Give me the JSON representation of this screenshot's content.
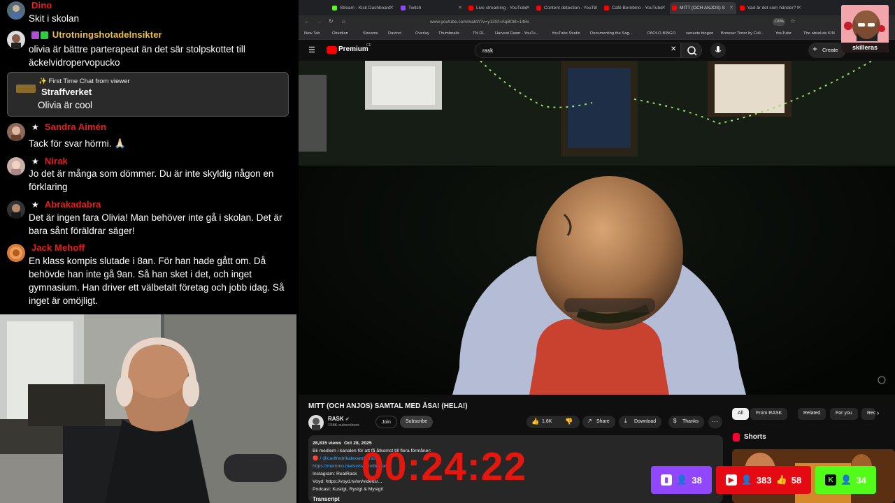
{
  "chat": {
    "messages": [
      {
        "user": "Dino",
        "color": "#e91e1e",
        "text": "Skit i skolan",
        "star": false
      },
      {
        "user": "UtrotningshotadeInsikter",
        "color": "#f0c040",
        "text": "olivia är bättre parterapeut än det sär stolpskottet till äckelvidropervopucko",
        "star": false
      },
      {
        "user": "Sandra Aimén",
        "color": "#e91e1e",
        "text": "Tack för svar hörrni. 🙏🏻",
        "star": true
      },
      {
        "user": "Nirak",
        "color": "#e91e1e",
        "text": "Jo det är många som dömmer. Du är inte skyldig någon en förklaring",
        "star": true
      },
      {
        "user": "Abrakadabra",
        "color": "#e91e1e",
        "text": "Det är ingen fara Olivia! Man behöver inte gå i skolan. Det är bara sånt föräldrar säger!",
        "star": true
      },
      {
        "user": "Jack Mehoff",
        "color": "#e91e1e",
        "text": "En klass kompis slutade i 8an. För han hade gått om. Då behövde han inte gå 9an. Så han sket i det, och inget gymnasium. Han driver ett välbetalt företag och jobb idag. Så inget är omöjligt.",
        "star": false
      }
    ],
    "first_time": {
      "header": "✨ First Time Chat from viewer",
      "user": "Straffverket",
      "text": "Olivia är cool"
    }
  },
  "browser": {
    "tabs": [
      {
        "label": "Stream - Kick Dashboard",
        "color": "#53fc18"
      },
      {
        "label": "Twitch",
        "color": "#9146ff"
      },
      {
        "label": "Live streaming - YouTube",
        "color": "#ff0000"
      },
      {
        "label": "Content detection - YouTu",
        "color": "#ff0000"
      },
      {
        "label": "Café Bernbino - YouTube",
        "color": "#ff0000"
      },
      {
        "label": "MITT (OCH ANJOS) S",
        "color": "#ff0000"
      },
      {
        "label": "Vad är det som händer? I",
        "color": "#ff0000"
      }
    ],
    "url": "www.youtube.com/watch?v=y13Sf-lAqB08t=148s",
    "zoom": "110%",
    "bookmarks": [
      "New Tab",
      "Obsidian",
      "Streams",
      "Davinci",
      "Overlay",
      "Thumbnails",
      "TN DL",
      "Harvest Dawn - YouTu...",
      "YouTube Studio",
      "Documenting the Sag...",
      "PAOLO-BINGO",
      "senaste bingoo",
      "Browser Timer by Coll...",
      "YouTube",
      "The absolute KIN"
    ]
  },
  "youtube": {
    "logo_text": "Premium",
    "logo_sup": "CE",
    "search_value": "rask",
    "create_label": "Create",
    "video_title": "MITT (OCH ANJOS) SAMTAL MED ÅSA! (HELA!)",
    "channel_name": "RASK",
    "subscribers": "158K subscribers",
    "join_label": "Join",
    "subscribe_label": "Subscribe",
    "likes": "1.6K",
    "share_label": "Share",
    "download_label": "Download",
    "thanks_label": "Thanks",
    "views": "28,815 views",
    "date": "Oct 28, 2025",
    "desc_line1": "Bli medlem i kanalen för att få åtkomst till flera förmåner:",
    "desc_line2": "🔴 / @carlfredrikalexanderrask",
    "desc_line3": "https://memmo.me/sv/sv/profile/carl-f",
    "desc_line4": "Instagram: RealRask",
    "desc_line5": "Voyd: https://voyd.tv/en/videos/...",
    "desc_line6": "Podcast: Kusligt, Ryslgt & Mysigt!",
    "desc_line7": "Transcript",
    "chips": [
      "All",
      "From RASK",
      "Related",
      "For you",
      "Rec"
    ],
    "shorts_label": "Shorts"
  },
  "overlay": {
    "timer": "00:24:22",
    "twitch_count": "38",
    "youtube_count": "383",
    "youtube_likes": "58",
    "kick_count": "34",
    "skilleras_label": "skilleras",
    "twitch_color": "#9146ff",
    "youtube_color": "#e50914",
    "kick_color": "#53fc18"
  }
}
